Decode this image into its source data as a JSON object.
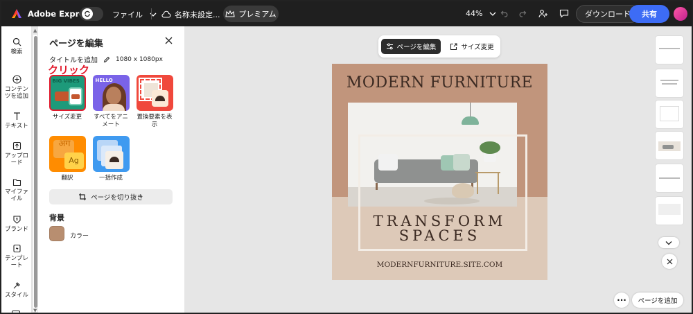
{
  "app": {
    "name": "Adobe Express"
  },
  "topbar": {
    "file_menu": "ファイル",
    "doc_title": "名称未設定...",
    "premium": "プレミアム",
    "zoom": "44%",
    "download": "ダウンロード",
    "share": "共有"
  },
  "rail": {
    "items": [
      {
        "label": "検索",
        "icon": "search-icon"
      },
      {
        "label": "コンテンツを追加",
        "icon": "plus-circle-icon"
      },
      {
        "label": "テキスト",
        "icon": "text-icon"
      },
      {
        "label": "アップロード",
        "icon": "upload-icon"
      },
      {
        "label": "マイファイル",
        "icon": "folder-icon"
      },
      {
        "label": "ブランド",
        "icon": "brand-icon"
      },
      {
        "label": "テンプレート",
        "icon": "template-icon"
      },
      {
        "label": "スタイル",
        "icon": "style-icon"
      }
    ]
  },
  "panel": {
    "title": "ページを編集",
    "title_add": "タイトルを追加",
    "size": "1080 x 1080px",
    "annotation": "クリック",
    "tools": [
      {
        "label": "サイズ変更"
      },
      {
        "label": "すべてをアニメート"
      },
      {
        "label": "置換要素を表示"
      },
      {
        "label": "翻訳"
      },
      {
        "label": "一括作成"
      }
    ],
    "crop": "ページを切り抜き",
    "background_title": "背景",
    "color_label": "カラー",
    "bg_color": "#b88e70",
    "thumb_texts": {
      "resize_top": "BIG VIBES",
      "animate_top": "HELLO",
      "translate_glyph": "अग",
      "translate_latin": "Ag"
    }
  },
  "canvas_toolbar": {
    "edit_page": "ページを編集",
    "resize": "サイズ変更"
  },
  "design": {
    "headline": "MODERN FURNITURE",
    "sub1": "TRANSFORM",
    "sub2": "SPACES",
    "url": "MODERNFURNITURE.SITE.COM"
  },
  "bottom": {
    "add_page": "ページを追加"
  },
  "colors": {
    "accent": "#3d6cf5",
    "annotation": "#e21b2d",
    "topbar": "#1f1f1f"
  }
}
